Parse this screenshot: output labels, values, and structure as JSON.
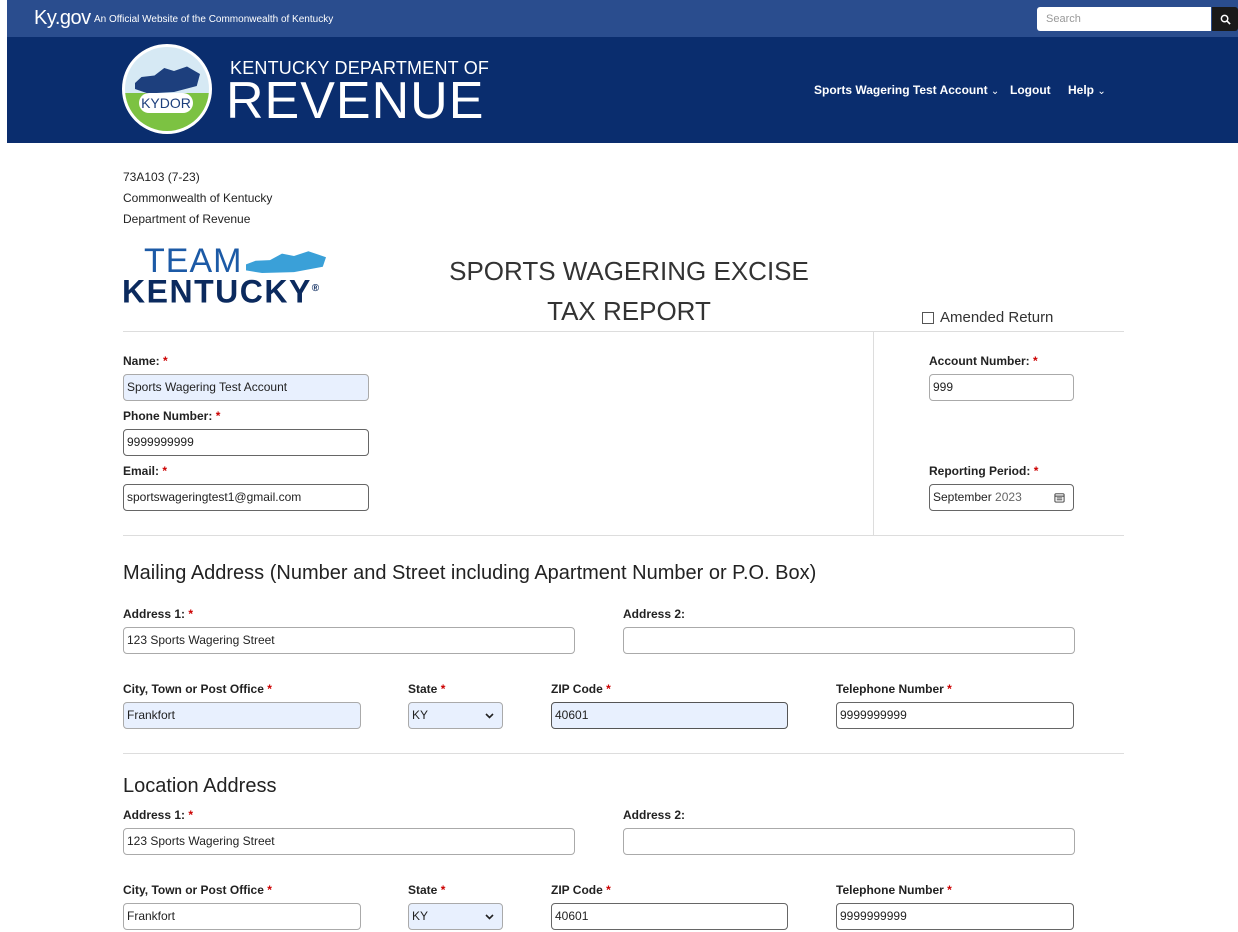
{
  "govbar": {
    "logo": "Ky.gov",
    "tagline": "An Official Website of the Commonwealth of Kentucky",
    "search_placeholder": "Search",
    "search_icon": "search-icon"
  },
  "header": {
    "seal_text": "KYDOR",
    "dept_small": "KENTUCKY DEPARTMENT OF",
    "dept_big": "REVENUE",
    "nav": {
      "account": "Sports Wagering Test Account",
      "logout": "Logout",
      "help": "Help",
      "chevron": "⌄"
    }
  },
  "form_meta": {
    "form_number": "73A103 (7-23)",
    "line2": "Commonwealth of Kentucky",
    "line3": "Department of Revenue"
  },
  "team_logo": {
    "team": "TEAM",
    "kentucky": "KENTUCKY"
  },
  "report": {
    "title_line1": "SPORTS WAGERING EXCISE",
    "title_line2": "TAX REPORT",
    "amended_label": "Amended Return"
  },
  "taxpayer": {
    "name_label": "Name:",
    "name_value": "Sports Wagering Test Account",
    "phone_label": "Phone Number:",
    "phone_value": "9999999999",
    "email_label": "Email:",
    "email_value": "sportswageringtest1@gmail.com",
    "account_label": "Account Number:",
    "account_value": "999",
    "period_label": "Reporting Period:",
    "period_month": "September",
    "period_year": "2023",
    "required_mark": "*"
  },
  "mailing": {
    "heading": "Mailing Address (Number and Street including Apartment Number or P.O. Box)",
    "address1_label": "Address 1:",
    "address1_value": "123 Sports Wagering Street",
    "address2_label": "Address 2:",
    "address2_value": "",
    "city_label": "City, Town or Post Office",
    "city_value": "Frankfort",
    "state_label": "State",
    "state_value": "KY",
    "zip_label": "ZIP Code",
    "zip_value": "40601",
    "tel_label": "Telephone Number",
    "tel_value": "9999999999"
  },
  "location": {
    "heading": "Location Address",
    "address1_label": "Address 1:",
    "address1_value": "123 Sports Wagering Street",
    "address2_label": "Address 2:",
    "address2_value": "",
    "city_label": "City, Town or Post Office",
    "city_value": "Frankfort",
    "state_label": "State",
    "state_value": "KY",
    "zip_label": "ZIP Code",
    "zip_value": "40601",
    "tel_label": "Telephone Number",
    "tel_value": "9999999999"
  }
}
